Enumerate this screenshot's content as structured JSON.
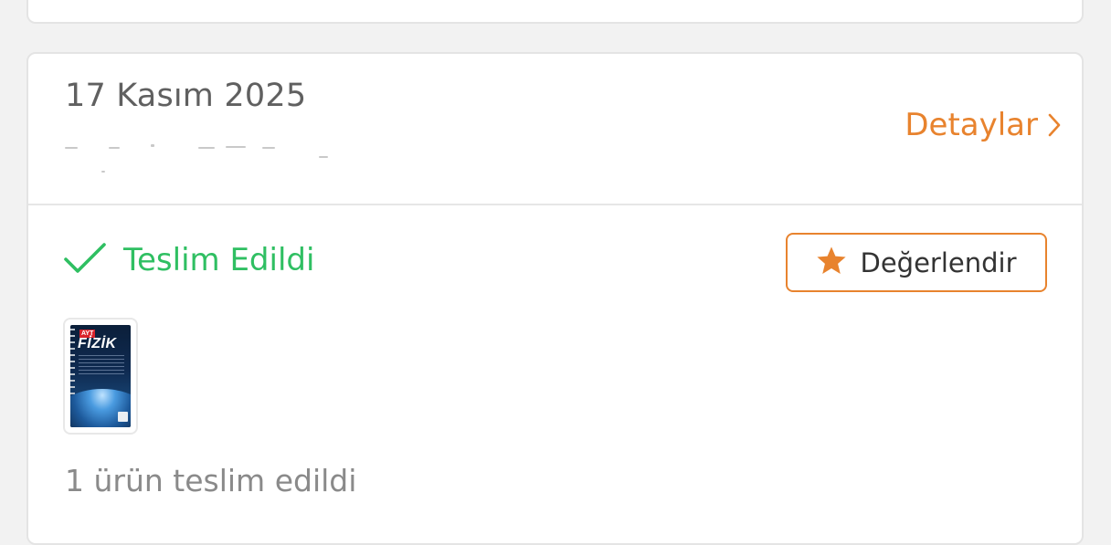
{
  "order": {
    "date": "17 Kasım 2025",
    "details_label": "Detaylar",
    "status_label": "Teslim Edildi",
    "rate_label": "Değerlendir",
    "delivered_summary": "1 ürün teslim edildi"
  },
  "product": {
    "cover_tag": "AYT",
    "cover_title": "FİZİK"
  },
  "colors": {
    "accent_orange": "#e8832e",
    "status_green": "#2fbf62",
    "text_primary": "#333333",
    "text_muted": "#8a8a8a",
    "background": "#f2f2f2",
    "card": "#ffffff"
  },
  "icons": {
    "details": "chevron-right-icon",
    "status": "check-icon",
    "rate": "star-icon"
  }
}
